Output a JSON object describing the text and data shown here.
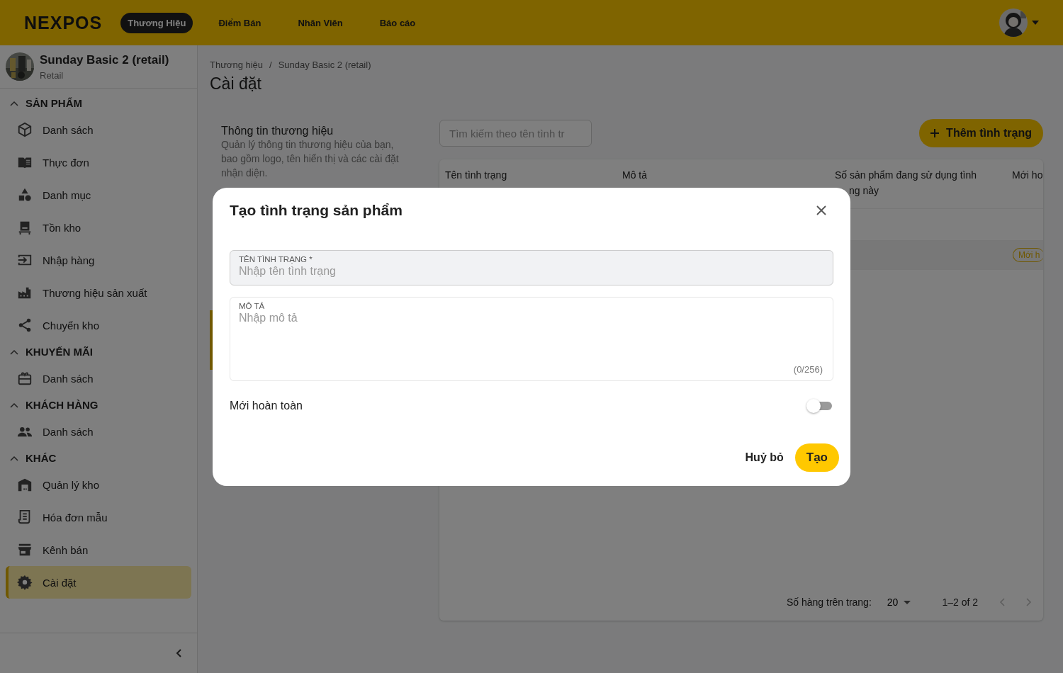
{
  "header": {
    "logo": "NEXPOS",
    "nav": [
      {
        "label": "Thương Hiệu",
        "selected": true
      },
      {
        "label": "Điểm Bán",
        "selected": false
      },
      {
        "label": "Nhân Viên",
        "selected": false
      },
      {
        "label": "Báo cáo",
        "selected": false
      }
    ]
  },
  "sidebar": {
    "brand": {
      "name": "Sunday Basic 2 (retail)",
      "type": "Retail"
    },
    "sections": [
      {
        "title": "SẢN PHẨM",
        "expanded": true,
        "items": [
          {
            "label": "Danh sách",
            "kind": "box",
            "selected": false
          },
          {
            "label": "Thực đơn",
            "kind": "book",
            "selected": false
          },
          {
            "label": "Danh mục",
            "kind": "shapes",
            "selected": false
          },
          {
            "label": "Tồn kho",
            "kind": "kiosk",
            "selected": false
          },
          {
            "label": "Nhập hàng",
            "kind": "import",
            "selected": false
          },
          {
            "label": "Thương hiệu sản xuất",
            "kind": "factory",
            "selected": false
          },
          {
            "label": "Chuyển kho",
            "kind": "share",
            "selected": false
          }
        ]
      },
      {
        "title": "KHUYẾN MÃI",
        "expanded": true,
        "items": [
          {
            "label": "Danh sách",
            "kind": "gift",
            "selected": false
          }
        ]
      },
      {
        "title": "KHÁCH HÀNG",
        "expanded": true,
        "items": [
          {
            "label": "Danh sách",
            "kind": "people",
            "selected": false
          }
        ]
      },
      {
        "title": "KHÁC",
        "expanded": true,
        "items": [
          {
            "label": "Quản lý kho",
            "kind": "warehouse",
            "selected": false
          },
          {
            "label": "Hóa đơn mẫu",
            "kind": "receipt",
            "selected": false
          },
          {
            "label": "Kênh bán",
            "kind": "store",
            "selected": false
          },
          {
            "label": "Cài đặt",
            "kind": "gear",
            "selected": true
          }
        ]
      }
    ]
  },
  "breadcrumb": [
    "Thương hiệu",
    "Sunday Basic 2 (retail)"
  ],
  "breadcrumb_separator": "/",
  "page_title": "Cài đặt",
  "settings_section": {
    "title": "Thông tin thương hiệu",
    "description": "Quản lý thông tin thương hiệu của bạn, bao gồm logo, tên hiển thị và các cài đặt nhận diện."
  },
  "search": {
    "placeholder": "Tìm kiếm theo tên tình tr"
  },
  "add_button": "Thêm tình trạng",
  "table": {
    "columns": [
      "Tên tình trạng",
      "Mô tả",
      "Số sản phẩm đang sử dụng tình",
      "Mới ho"
    ],
    "column_3_line_2": "ng này",
    "rows": [
      {
        "badge": null,
        "selected": false
      },
      {
        "badge": "Mới h",
        "selected": true
      }
    ]
  },
  "pagination": {
    "rows_label": "Số hàng trên trang:",
    "rows_per_page": "20",
    "range": "1–2 of 2"
  },
  "dialog": {
    "title": "Tạo tình trạng sản phẩm",
    "name_field": {
      "label": "TÊN TÌNH TRẠNG *",
      "placeholder": "Nhập tên tình trạng"
    },
    "description_field": {
      "label": "MÔ TẢ",
      "placeholder": "Nhập mô tả",
      "counter": "(0/256)"
    },
    "toggle": {
      "label": "Mới hoàn toàn",
      "on": false
    },
    "buttons": {
      "cancel": "Huỷ bỏ",
      "confirm": "Tạo"
    }
  }
}
